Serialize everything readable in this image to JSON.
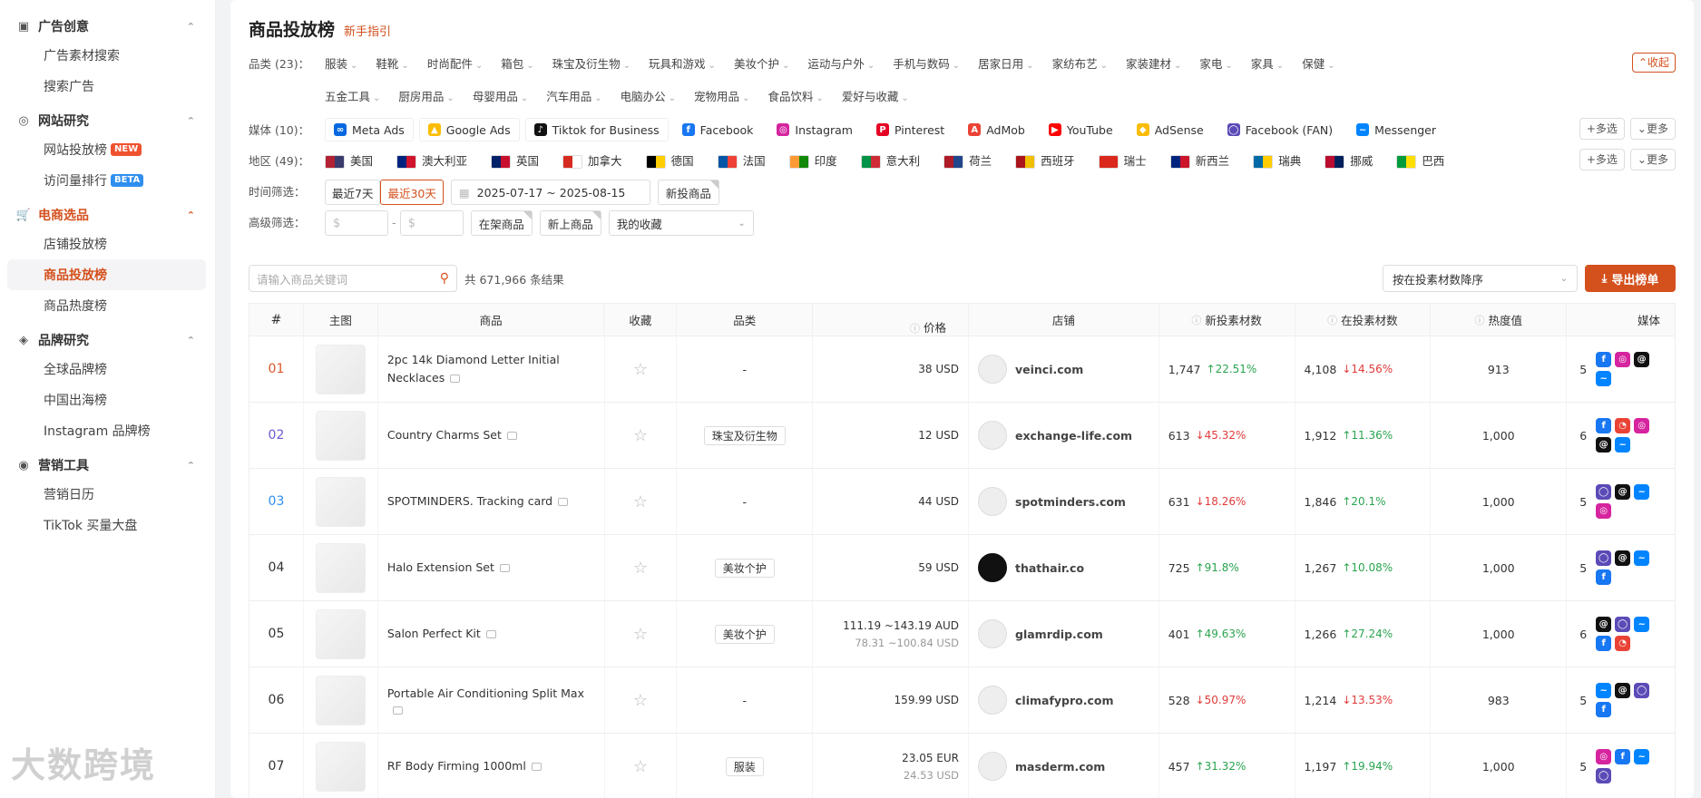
{
  "sidebar": {
    "groups": [
      {
        "title": "广告创意",
        "icon": "image-icon",
        "items": [
          {
            "label": "广告素材搜索"
          },
          {
            "label": "搜索广告"
          }
        ]
      },
      {
        "title": "网站研究",
        "icon": "compass-icon",
        "items": [
          {
            "label": "网站投放榜",
            "badge": "NEW"
          },
          {
            "label": "访问量排行",
            "badge": "BETA"
          }
        ]
      },
      {
        "title": "电商选品",
        "icon": "cart-icon",
        "items": [
          {
            "label": "店铺投放榜"
          },
          {
            "label": "商品投放榜"
          },
          {
            "label": "商品热度榜"
          }
        ]
      },
      {
        "title": "品牌研究",
        "icon": "brand-icon",
        "items": [
          {
            "label": "全球品牌榜"
          },
          {
            "label": "中国出海榜"
          },
          {
            "label": "Instagram 品牌榜"
          }
        ]
      },
      {
        "title": "营销工具",
        "icon": "broadcast-icon",
        "items": [
          {
            "label": "营销日历"
          },
          {
            "label": "TikTok 买量大盘"
          }
        ]
      }
    ],
    "watermark": "大数跨境"
  },
  "header": {
    "title": "商品投放榜",
    "guide": "新手指引"
  },
  "filters": {
    "category": {
      "label": "品类 (23)：",
      "row1": [
        "服装",
        "鞋靴",
        "时尚配件",
        "箱包",
        "珠宝及衍生物",
        "玩具和游戏",
        "美妆个护",
        "运动与户外",
        "手机与数码",
        "居家日用",
        "家纺布艺",
        "家装建材",
        "家电",
        "家具",
        "保健"
      ],
      "row2": [
        "五金工具",
        "厨房用品",
        "母婴用品",
        "汽车用品",
        "电脑办公",
        "宠物用品",
        "食品饮料",
        "爱好与收藏"
      ],
      "collapse": "收起"
    },
    "media": {
      "label": "媒体 (10)：",
      "boxed": [
        {
          "name": "Meta Ads",
          "icon": "meta-icon",
          "color": "#0668e1",
          "glyph": "∞"
        },
        {
          "name": "Google Ads",
          "icon": "google-ads-icon",
          "color": "#fbbc04",
          "glyph": "▲"
        },
        {
          "name": "Tiktok for Business",
          "icon": "tiktok-icon",
          "color": "#111111",
          "glyph": "♪"
        }
      ],
      "plain": [
        {
          "name": "Facebook",
          "icon": "facebook-icon",
          "color": "#1877f2",
          "glyph": "f"
        },
        {
          "name": "Instagram",
          "icon": "instagram-icon",
          "color": "#d6249f",
          "glyph": "◎"
        },
        {
          "name": "Pinterest",
          "icon": "pinterest-icon",
          "color": "#e60023",
          "glyph": "P"
        },
        {
          "name": "AdMob",
          "icon": "admob-icon",
          "color": "#ea4335",
          "glyph": "A"
        },
        {
          "name": "YouTube",
          "icon": "youtube-icon",
          "color": "#ff0000",
          "glyph": "▶"
        },
        {
          "name": "AdSense",
          "icon": "adsense-icon",
          "color": "#fbbc04",
          "glyph": "◆"
        },
        {
          "name": "Facebook (FAN)",
          "icon": "fan-icon",
          "color": "#5b4bb7",
          "glyph": "◯"
        },
        {
          "name": "Messenger",
          "icon": "messenger-icon",
          "color": "#0084ff",
          "glyph": "~"
        }
      ],
      "multi": "多选",
      "more": "更多"
    },
    "region": {
      "label": "地区 (49)：",
      "items": [
        {
          "name": "美国",
          "c1": "#b22234",
          "c2": "#3c3b6e"
        },
        {
          "name": "澳大利亚",
          "c1": "#00247d",
          "c2": "#cf142b"
        },
        {
          "name": "英国",
          "c1": "#012169",
          "c2": "#c8102e"
        },
        {
          "name": "加拿大",
          "c1": "#d52b1e",
          "c2": "#ffffff"
        },
        {
          "name": "德国",
          "c1": "#000000",
          "c2": "#ffce00"
        },
        {
          "name": "法国",
          "c1": "#0055a4",
          "c2": "#ef4135"
        },
        {
          "name": "印度",
          "c1": "#ff9933",
          "c2": "#138808"
        },
        {
          "name": "意大利",
          "c1": "#009246",
          "c2": "#ce2b37"
        },
        {
          "name": "荷兰",
          "c1": "#ae1c28",
          "c2": "#21468b"
        },
        {
          "name": "西班牙",
          "c1": "#aa151b",
          "c2": "#f1bf00"
        },
        {
          "name": "瑞士",
          "c1": "#da291c",
          "c2": "#da291c"
        },
        {
          "name": "新西兰",
          "c1": "#00247d",
          "c2": "#cc142b"
        },
        {
          "name": "瑞典",
          "c1": "#006aa7",
          "c2": "#fecc00"
        },
        {
          "name": "挪威",
          "c1": "#ba0c2f",
          "c2": "#00205b"
        },
        {
          "name": "巴西",
          "c1": "#009c3b",
          "c2": "#ffdf00"
        }
      ],
      "multi": "多选",
      "more": "更多"
    },
    "time": {
      "label": "时间筛选：",
      "opt7": "最近7天",
      "opt30": "最近30天",
      "range": "2025-07-17 ~ 2025-08-15",
      "new_tag": "新投商品"
    },
    "advanced": {
      "label": "高级筛选：",
      "min_ph": "$",
      "max_ph": "$",
      "on_shelf": "在架商品",
      "new_listed": "新上商品",
      "favorites": "我的收藏"
    }
  },
  "search": {
    "placeholder": "请输入商品关键词",
    "result": "共 671,966 条结果",
    "sort": "按在投素材数降序",
    "export": "导出榜单"
  },
  "table": {
    "headers": {
      "rank": "#",
      "image": "主图",
      "product": "商品",
      "fav": "收藏",
      "category": "品类",
      "price": "价格",
      "shop": "店铺",
      "new_ads": "新投素材数",
      "live_ads": "在投素材数",
      "heat": "热度值",
      "media": "媒体"
    },
    "rows": [
      {
        "rank": "01",
        "rank_color": "#e0572b",
        "name": "2pc 14k Diamond Letter Initial Necklaces",
        "category": "-",
        "price": "38 USD",
        "price_sub": "",
        "shop": "veinci.com",
        "new": "1,747",
        "new_dir": "up",
        "new_pct": "22.51%",
        "live": "4,108",
        "live_dir": "down",
        "live_pct": "14.56%",
        "heat": "913",
        "media_count": "5",
        "media": [
          "facebook-icon",
          "instagram-icon",
          "threads-icon",
          "messenger-icon"
        ]
      },
      {
        "rank": "02",
        "rank_color": "#6a5bd6",
        "name": "Country Charms Set",
        "category": "珠宝及衍生物",
        "price": "12 USD",
        "price_sub": "",
        "shop": "exchange-life.com",
        "new": "613",
        "new_dir": "down",
        "new_pct": "45.32%",
        "live": "1,912",
        "live_dir": "up",
        "live_pct": "11.36%",
        "heat": "1,000",
        "media_count": "6",
        "media": [
          "facebook-icon",
          "admob-icon",
          "instagram-icon",
          "threads-icon",
          "messenger-icon"
        ]
      },
      {
        "rank": "03",
        "rank_color": "#2f8ff0",
        "name": "SPOTMINDERS. Tracking card",
        "category": "-",
        "price": "44 USD",
        "price_sub": "",
        "shop": "spotminders.com",
        "new": "631",
        "new_dir": "down",
        "new_pct": "18.26%",
        "live": "1,846",
        "live_dir": "up",
        "live_pct": "20.1%",
        "heat": "1,000",
        "media_count": "5",
        "media": [
          "fan-icon",
          "threads-icon",
          "messenger-icon",
          "instagram-icon"
        ]
      },
      {
        "rank": "04",
        "rank_color": "#333333",
        "name": "Halo Extension Set",
        "category": "美妆个护",
        "price": "59 USD",
        "price_sub": "",
        "shop": "thathair.co",
        "new": "725",
        "new_dir": "up",
        "new_pct": "91.8%",
        "live": "1,267",
        "live_dir": "up",
        "live_pct": "10.08%",
        "heat": "1,000",
        "media_count": "5",
        "media": [
          "fan-icon",
          "threads-icon",
          "messenger-icon",
          "facebook-icon"
        ]
      },
      {
        "rank": "05",
        "rank_color": "#333333",
        "name": "Salon Perfect Kit",
        "category": "美妆个护",
        "price": "111.19 ~143.19 AUD",
        "price_sub": "78.31 ~100.84 USD",
        "shop": "glamrdip.com",
        "new": "401",
        "new_dir": "up",
        "new_pct": "49.63%",
        "live": "1,266",
        "live_dir": "up",
        "live_pct": "27.24%",
        "heat": "1,000",
        "media_count": "6",
        "media": [
          "threads-icon",
          "fan-icon",
          "messenger-icon",
          "facebook-icon",
          "admob-icon"
        ]
      },
      {
        "rank": "06",
        "rank_color": "#333333",
        "name": "Portable Air Conditioning Split Max",
        "category": "-",
        "price": "159.99 USD",
        "price_sub": "",
        "shop": "climafypro.com",
        "new": "528",
        "new_dir": "down",
        "new_pct": "50.97%",
        "live": "1,214",
        "live_dir": "down",
        "live_pct": "13.53%",
        "heat": "983",
        "media_count": "5",
        "media": [
          "messenger-icon",
          "threads-icon",
          "fan-icon",
          "facebook-icon"
        ]
      },
      {
        "rank": "07",
        "rank_color": "#333333",
        "name": "RF Body Firming 1000ml",
        "category": "服装",
        "price": "23.05 EUR",
        "price_sub": "24.53 USD",
        "shop": "masderm.com",
        "new": "457",
        "new_dir": "up",
        "new_pct": "31.32%",
        "live": "1,197",
        "live_dir": "up",
        "live_pct": "19.94%",
        "heat": "1,000",
        "media_count": "5",
        "media": [
          "instagram-icon",
          "facebook-icon",
          "messenger-icon",
          "fan-icon"
        ]
      }
    ]
  }
}
